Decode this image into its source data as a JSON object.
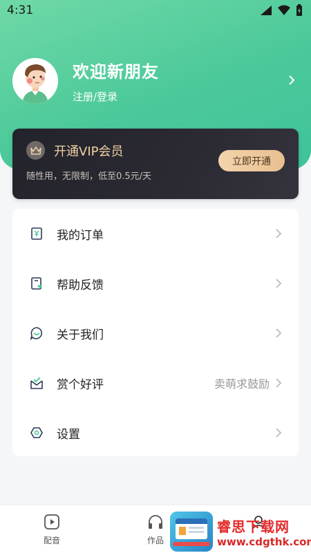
{
  "status_bar": {
    "time": "4:31"
  },
  "profile": {
    "greeting": "欢迎新朋友",
    "login_link": "注册/登录"
  },
  "vip": {
    "title": "开通VIP会员",
    "subtitle": "随性用，无限制，低至0.5元/天",
    "button_label": "立即开通"
  },
  "menu": {
    "items": [
      {
        "label": "我的订单",
        "hint": "",
        "icon": "order-icon"
      },
      {
        "label": "帮助反馈",
        "hint": "",
        "icon": "feedback-icon"
      },
      {
        "label": "关于我们",
        "hint": "",
        "icon": "chat-bubble-icon"
      },
      {
        "label": "赏个好评",
        "hint": "卖萌求鼓励",
        "icon": "rating-mail-icon"
      },
      {
        "label": "设置",
        "hint": "",
        "icon": "settings-hexagon-icon"
      }
    ]
  },
  "bottom_nav": {
    "items": [
      {
        "label": "配音",
        "icon": "play-square-icon"
      },
      {
        "label": "作品",
        "icon": "headphones-icon"
      }
    ]
  },
  "watermark": {
    "title": "睿思下载网",
    "url": "www.cdgthk.com"
  },
  "colors": {
    "header_gradient_start": "#6fd9a6",
    "header_gradient_end": "#3fc39b",
    "vip_card": "#23232b",
    "vip_gold": "#f0d1a6",
    "vip_button": "#f3d4ac",
    "watermark_red": "#e32b2b"
  }
}
